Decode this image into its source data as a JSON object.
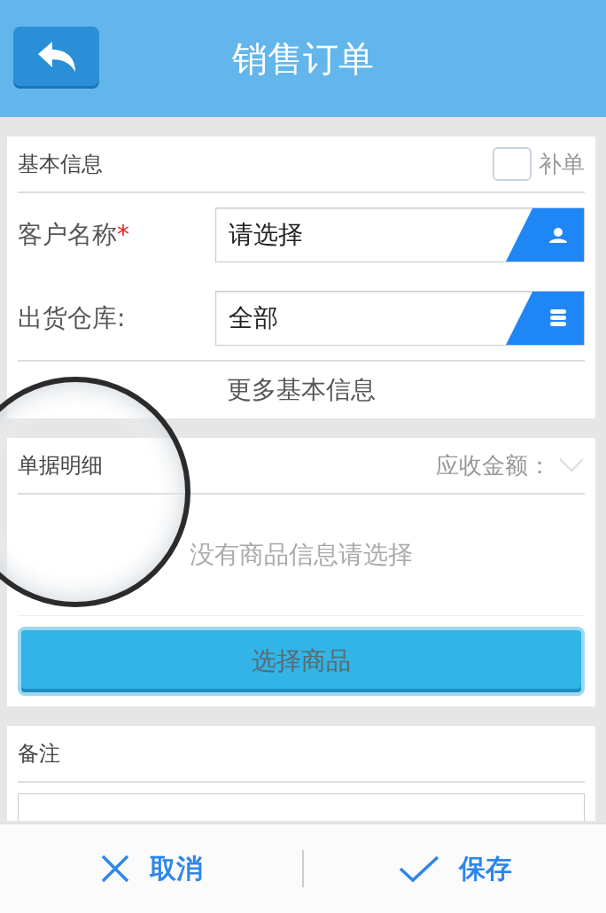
{
  "header": {
    "title": "销售订单"
  },
  "basic_info": {
    "title": "基本信息",
    "required_mark": "*",
    "supplement": {
      "label": "补单",
      "checked": false
    },
    "fields": [
      {
        "label": "客户名称",
        "required": true,
        "value": "请选择",
        "kind": "person"
      },
      {
        "label": "出货仓库:",
        "required": false,
        "value": "全部",
        "kind": "stack"
      }
    ],
    "more": "更多基本信息"
  },
  "details": {
    "title": "单据明细",
    "amount_label": "应收金额：",
    "expanded": false,
    "empty_text": "没有商品信息请选择",
    "button": "选择商品"
  },
  "remarks": {
    "title": "备注"
  },
  "footer": {
    "cancel": "取消",
    "save": "保存"
  }
}
